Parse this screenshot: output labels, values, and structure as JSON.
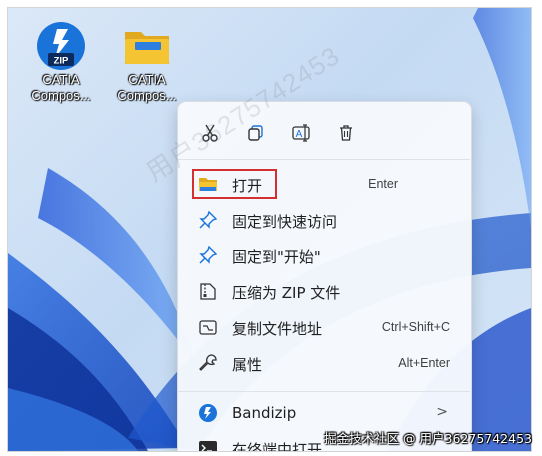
{
  "desktop": {
    "icons": [
      {
        "name": "CATIA",
        "sub": "Compos...",
        "kind": "zip-icon"
      },
      {
        "name": "CATIA",
        "sub": "Compos...",
        "kind": "folder-icon"
      }
    ],
    "zip_badge": "ZIP"
  },
  "context_menu": {
    "toolbar": [
      "cut-icon",
      "copy-icon",
      "rename-icon",
      "delete-icon"
    ],
    "items": [
      {
        "label": "打开",
        "shortcut": "Enter",
        "icon": "folder-icon"
      },
      {
        "label": "固定到快速访问",
        "shortcut": "",
        "icon": "pin-icon"
      },
      {
        "label": "固定到\"开始\"",
        "shortcut": "",
        "icon": "pin-start-icon"
      },
      {
        "label": "压缩为 ZIP 文件",
        "shortcut": "",
        "icon": "zip-archive-icon"
      },
      {
        "label": "复制文件地址",
        "shortcut": "Ctrl+Shift+C",
        "icon": "copy-path-icon"
      },
      {
        "label": "属性",
        "shortcut": "Alt+Enter",
        "icon": "wrench-icon"
      },
      {
        "label": "Bandizip",
        "shortcut": "",
        "icon": "bandizip-icon",
        "submenu_arrow": ">"
      },
      {
        "label": "在终端中打开",
        "shortcut": "",
        "icon": "terminal-icon"
      }
    ]
  },
  "watermark": "用户36275742453",
  "credit": "掘金技术社区 @ 用户36275742453",
  "colors": {
    "accent": "#1a73d9",
    "highlight_box": "#d62f2f",
    "folder": "#f5c433"
  }
}
